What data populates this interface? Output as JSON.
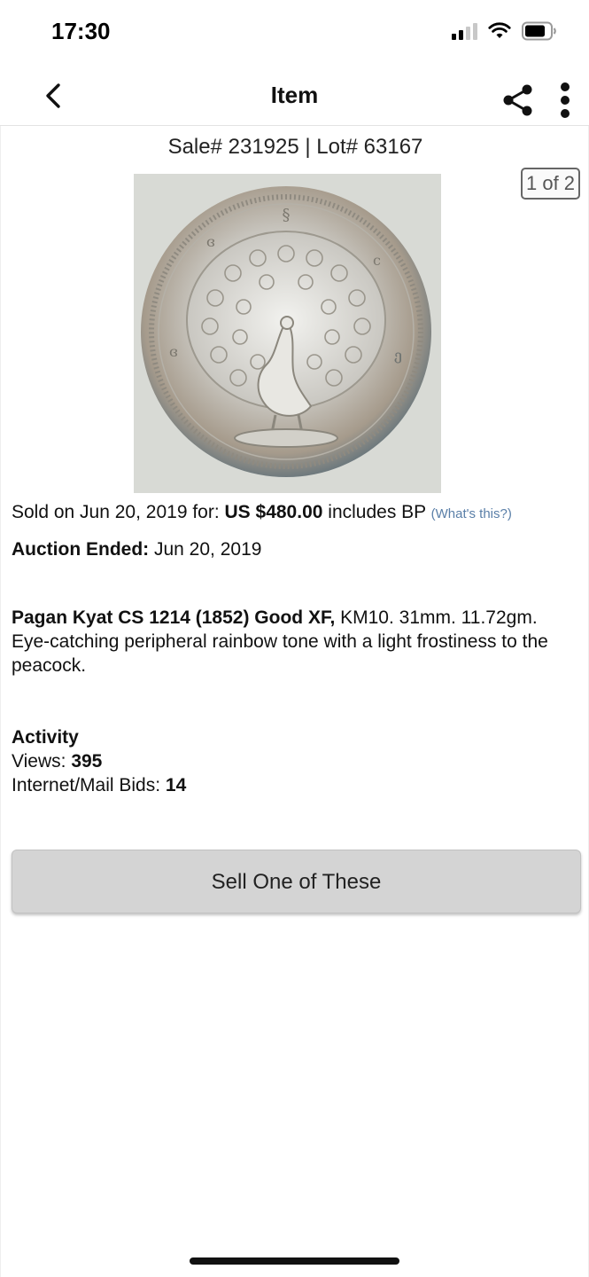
{
  "status": {
    "time": "17:30",
    "icons": [
      "signal-icon",
      "wifi-icon",
      "battery-icon"
    ]
  },
  "nav": {
    "title": "Item",
    "back_icon": "chevron-left-icon",
    "share_icon": "share-icon",
    "more_icon": "more-vertical-icon"
  },
  "item": {
    "sale_lot": "Sale# 231925 | Lot# 63167",
    "photo_counter": "1 of 2",
    "sold_prefix": "Sold on Jun 20, 2019 for: ",
    "sold_price": "US $480.00",
    "sold_suffix": " includes BP ",
    "whats_this": "(What's this?)",
    "ended_label": "Auction Ended:",
    "ended_value": " Jun 20, 2019",
    "title": "Pagan Kyat CS 1214 (1852) Good XF,",
    "description": " KM10. 31mm. 11.72gm. Eye-catching peripheral rainbow tone with a light frostiness to the peacock."
  },
  "activity": {
    "heading": "Activity",
    "views_label": "Views: ",
    "views_value": "395",
    "bids_label": "Internet/Mail Bids: ",
    "bids_value": "14"
  },
  "actions": {
    "sell_label": "Sell One of These"
  }
}
